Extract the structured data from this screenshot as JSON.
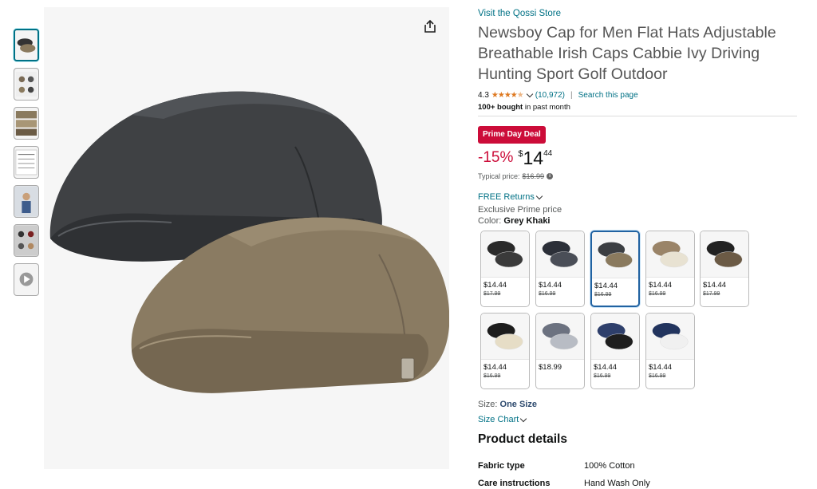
{
  "store_link": "Visit the Qossi Store",
  "product_title": "Newsboy Cap for Men Flat Hats Adjustable Breathable Irish Caps Cabbie Ivy Driving Hunting Sport Golf Outdoor",
  "rating": {
    "value": "4.3",
    "stars_filled": 4.3,
    "count_text": "(10,972)",
    "search_link": "Search this page",
    "separator": "|"
  },
  "bought": {
    "bold": "100+ bought",
    "rest": " in past month"
  },
  "deal_badge": "Prime Day Deal",
  "price": {
    "discount": "-15%",
    "symbol": "$",
    "whole": "14",
    "fraction": "44",
    "typical_label": "Typical price:",
    "typical_value": "$16.99",
    "info_icon": "i"
  },
  "returns": "FREE Returns",
  "exclusive": "Exclusive Prime price",
  "color": {
    "label": "Color:",
    "value": "Grey Khaki"
  },
  "swatches": [
    {
      "price": "$14.44",
      "strike": "$17.99",
      "colors": [
        "#2a2a2a",
        "#3a3a3a"
      ],
      "selected": false
    },
    {
      "price": "$14.44",
      "strike": "$16.99",
      "colors": [
        "#2b2f38",
        "#4a4e57"
      ],
      "selected": false
    },
    {
      "price": "$14.44",
      "strike": "$16.99",
      "colors": [
        "#3b3e42",
        "#8a7a5e"
      ],
      "selected": true
    },
    {
      "price": "$14.44",
      "strike": "$16.99",
      "colors": [
        "#9a8468",
        "#e8e2d2"
      ],
      "selected": false
    },
    {
      "price": "$14.44",
      "strike": "$17.99",
      "colors": [
        "#222222",
        "#6b5a45"
      ],
      "selected": false
    },
    {
      "price": "$14.44",
      "strike": "$16.99",
      "colors": [
        "#1c1c1c",
        "#e6ddc6"
      ],
      "selected": false
    },
    {
      "price": "$18.99",
      "strike": "",
      "colors": [
        "#6c7280",
        "#b8bcc4"
      ],
      "selected": false
    },
    {
      "price": "$14.44",
      "strike": "$16.99",
      "colors": [
        "#2e3f6b",
        "#1e1e1e"
      ],
      "selected": false
    },
    {
      "price": "$14.44",
      "strike": "$16.99",
      "colors": [
        "#22345e",
        "#f0f0f0"
      ],
      "selected": false
    }
  ],
  "size": {
    "label": "Size:",
    "value": "One Size"
  },
  "size_chart": "Size Chart",
  "product_details": {
    "title": "Product details",
    "rows": [
      {
        "key": "Fabric type",
        "value": "100% Cotton"
      },
      {
        "key": "Care instructions",
        "value": "Hand Wash Only"
      }
    ]
  },
  "icons": {
    "share": "share-icon",
    "star": "star-icon",
    "chevron": "chevron-down-icon"
  },
  "colors": {
    "link": "#007185",
    "deal": "#cc0c39",
    "star": "#de7921",
    "selected_border": "#2162a1"
  }
}
